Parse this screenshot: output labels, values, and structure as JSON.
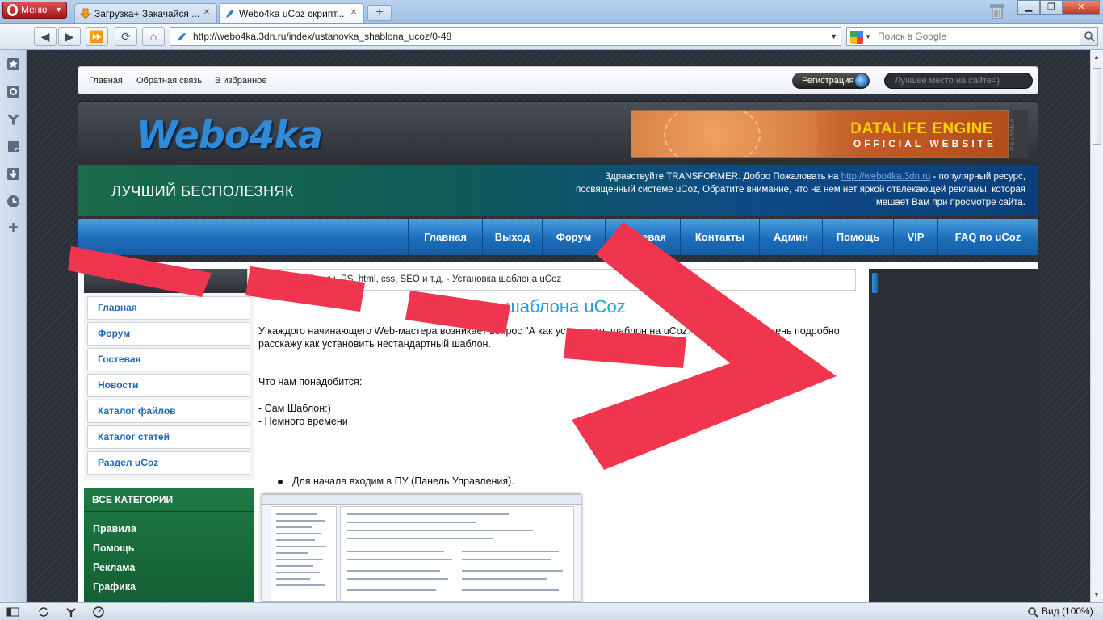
{
  "browser": {
    "menu_label": "Меню",
    "tabs": [
      {
        "label": "Загрузка+ Закачайся ..."
      },
      {
        "label": "Webo4ka uCoz скрипт..."
      }
    ],
    "new_tab": "+",
    "url": "http://webo4ka.3dn.ru/index/ustanovka_shablona_ucoz/0-48",
    "search_placeholder": "Поиск в Google",
    "zoom_label": "Вид (100%)"
  },
  "page": {
    "topnav": [
      "Главная",
      "Обратная связь",
      "В избранное"
    ],
    "register_label": "Регистрация",
    "site_search_placeholder": "Лучшее место на сайте=)",
    "logo": "Webo4ka",
    "banner": {
      "title": "DATALIFE ENGINE",
      "subtitle": "OFFICIAL WEBSITE",
      "ad_label": "РЕКЛАМА"
    },
    "slogan": "ЛУЧШИЙ БЕСПОЛЕЗНЯК",
    "welcome": {
      "pre": "Здравствуйте TRANSFORMER. Добро Пожаловать на",
      "link": "http://webo4ka.3dn.ru",
      "post": "- популярный ресурс, посвященный системе uCoz, Обратите внимание, что на нем нет яркой отвлекающей рекламы, которая мешает Вам при просмотре сайта."
    },
    "mainnav": [
      "Главная",
      "Выход",
      "Форум",
      "Гостевая",
      "Контакты",
      "Админ",
      "Помощь",
      "VIP",
      "FAQ по uCoz"
    ],
    "breadcrumb": "Скрипты/шаблоны, PS, html, css, SEO и т.д. - Установка шаблона uCoz",
    "sidebar": {
      "items": [
        "Главная",
        "Форум",
        "Гостевая",
        "Новости",
        "Каталог файлов",
        "Каталог статей",
        "Раздел uCoz"
      ]
    },
    "categories": {
      "title": "ВСЕ КАТЕГОРИИ",
      "items": [
        "Правила",
        "Помощь",
        "Реклама",
        "Графика"
      ]
    },
    "article": {
      "title": "Установка шаблона uCoz",
      "intro": "У каждого начинающего Web-мастера возникает вопрос \"А как установить шаблон на uCoz?\" В этом FAQ я очень подробно расскажу как установить нестандартный шаблон.",
      "need_label": "Что нам понадобится:",
      "need_1": "- Сам Шаблон:)",
      "need_2": "- Немного времени",
      "step_1": "Для начала входим в ПУ (Панель Управления)."
    }
  },
  "colors": {
    "overlay_red": "#f0364e",
    "link_blue": "#1c68b8",
    "title_blue": "#1f9fd8"
  }
}
